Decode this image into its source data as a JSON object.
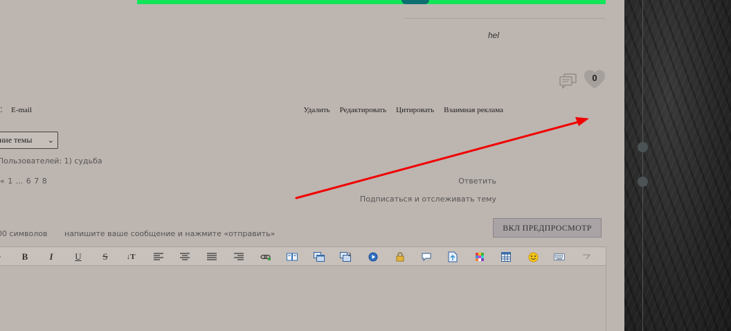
{
  "signature": "hel",
  "reactions": {
    "count": "0"
  },
  "profile_links": [
    "С",
    "E-mail"
  ],
  "post_actions": [
    "Удалить",
    "Редактировать",
    "Цитировать",
    "Взаимная реклама"
  ],
  "jump_select": {
    "selected": "ние темы"
  },
  "online_text": "Пользователей: 1) судьба",
  "pagination": "« 1 ... 6 7 8",
  "reply_link": "Ответить",
  "subscribe_link": "Подписаться и отслеживать тему",
  "char_count": "00 символов",
  "hint": "напишите ваше сообщение и нажмите «отправить»",
  "preview_button": "ВКЛ ПРЕДПРОСМОТР",
  "toolbar": {
    "bold": "B",
    "italic": "I",
    "underline": "U",
    "strike": "S",
    "font_size": "↓T"
  },
  "colors": {
    "background": "#bdb5b0",
    "banner": "#12e55a",
    "arrow": "#ff0000",
    "sidebar": "#262626"
  }
}
